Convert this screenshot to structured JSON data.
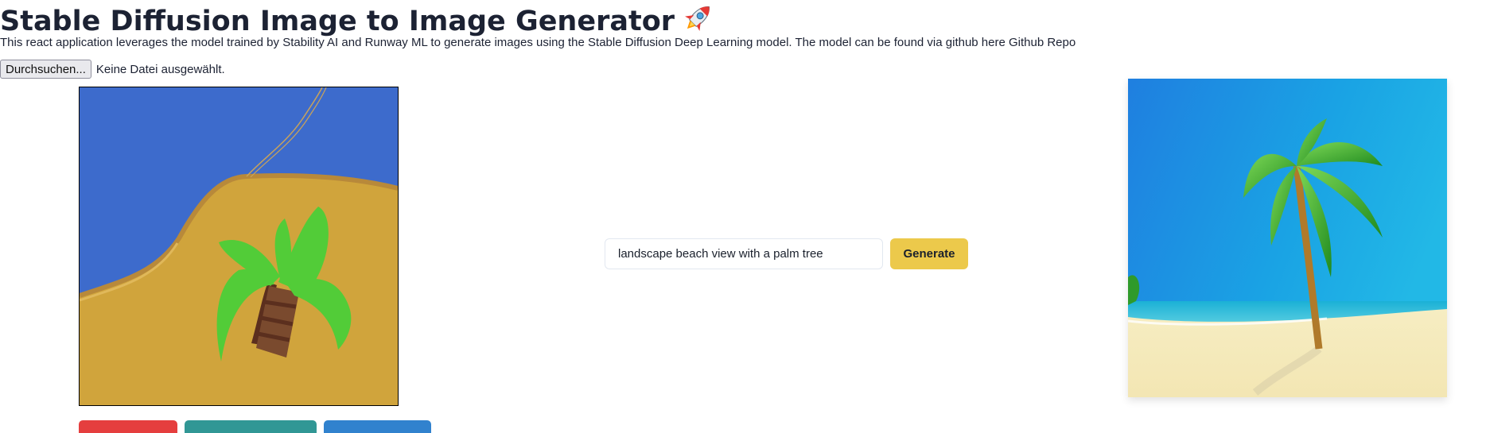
{
  "header": {
    "title": "Stable Diffusion Image to Image Generator",
    "title_icon": "rocket-icon",
    "description": "This react application leverages the model trained by Stability AI and Runway ML to generate images using the Stable Diffusion Deep Learning model. The model can be found via github here Github Repo"
  },
  "file_input": {
    "button_label": "Durchsuchen...",
    "status_text": "Keine Datei ausgewählt."
  },
  "sketch_canvas": {
    "content": "hand-drawn beach with palm tree",
    "colors": {
      "sky": "#3d6bcc",
      "sand": "#d0a43c",
      "leaves": "#52cc38",
      "trunk": "#7a4a2e"
    }
  },
  "toolbar": {
    "buttons": [
      {
        "name": "red-button",
        "color": "#e53e3e"
      },
      {
        "name": "teal-button",
        "color": "#319795"
      },
      {
        "name": "blue-button",
        "color": "#3182ce"
      }
    ]
  },
  "prompt": {
    "value": "landscape beach view with a palm tree",
    "generate_label": "Generate"
  },
  "colors": {
    "accent_yellow": "#ecc94b",
    "text_dark": "#1c2233"
  }
}
